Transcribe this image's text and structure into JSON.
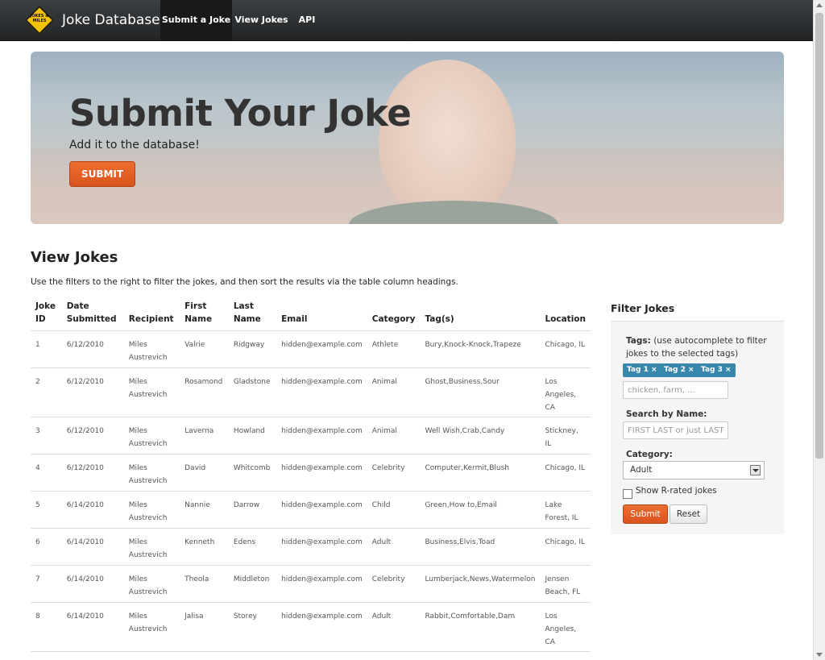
{
  "nav": {
    "logo_text": "JOKES & MILES",
    "brand": "Joke Database",
    "items": [
      "Submit a Joke",
      "View Jokes",
      "API"
    ]
  },
  "hero": {
    "title": "Submit Your Joke",
    "subtitle": "Add it to the database!",
    "button": "SUBMIT"
  },
  "main": {
    "title": "View Jokes",
    "intro": "Use the filters to the right to filter the jokes, and then sort the results via the table column headings."
  },
  "table": {
    "headers": [
      "Joke ID",
      "Date Submitted",
      "Recipient",
      "First Name",
      "Last Name",
      "Email",
      "Category",
      "Tag(s)",
      "Location"
    ],
    "rows": [
      [
        "1",
        "6/12/2010",
        "Miles Austrevich",
        "Valrie",
        "Ridgway",
        "hidden@example.com",
        "Athlete",
        "Bury,Knock-Knock,Trapeze",
        "Chicago, IL"
      ],
      [
        "2",
        "6/12/2010",
        "Miles Austrevich",
        "Rosamond",
        "Gladstone",
        "hidden@example.com",
        "Animal",
        "Ghost,Business,Sour",
        "Los Angeles, CA"
      ],
      [
        "3",
        "6/12/2010",
        "Miles Austrevich",
        "Laverna",
        "Howland",
        "hidden@example.com",
        "Animal",
        "Well Wish,Crab,Candy",
        "Stickney, IL"
      ],
      [
        "4",
        "6/12/2010",
        "Miles Austrevich",
        "David",
        "Whitcomb",
        "hidden@example.com",
        "Celebrity",
        "Computer,Kermit,Blush",
        "Chicago, IL"
      ],
      [
        "5",
        "6/14/2010",
        "Miles Austrevich",
        "Nannie",
        "Darrow",
        "hidden@example.com",
        "Child",
        "Green,How to,Email",
        "Lake Forest, IL"
      ],
      [
        "6",
        "6/14/2010",
        "Miles Austrevich",
        "Kenneth",
        "Edens",
        "hidden@example.com",
        "Adult",
        "Business,Elvis,Toad",
        "Chicago, IL"
      ],
      [
        "7",
        "6/14/2010",
        "Miles Austrevich",
        "Theola",
        "Middleton",
        "hidden@example.com",
        "Celebrity",
        "Lumberjack,News,Watermelon",
        "Jensen Beach, FL"
      ],
      [
        "8",
        "6/14/2010",
        "Miles Austrevich",
        "Jalisa",
        "Storey",
        "hidden@example.com",
        "Adult",
        "Rabbit,Comfortable,Dam",
        "Los Angeles, CA"
      ]
    ]
  },
  "filter": {
    "title": "Filter Jokes",
    "tags_label": "Tags:",
    "tags_hint": "(use autocomplete to filter jokes to the selected tags)",
    "tags": [
      "Tag 1",
      "Tag 2",
      "Tag 3"
    ],
    "tag_remove": "×",
    "tags_placeholder": "chicken, farm, ...",
    "name_label": "Search by Name:",
    "name_placeholder": "FIRST LAST or just LAST",
    "category_label": "Category:",
    "category_value": "Adult",
    "rated_label": "Show R-rated jokes",
    "submit": "Submit",
    "reset": "Reset"
  }
}
